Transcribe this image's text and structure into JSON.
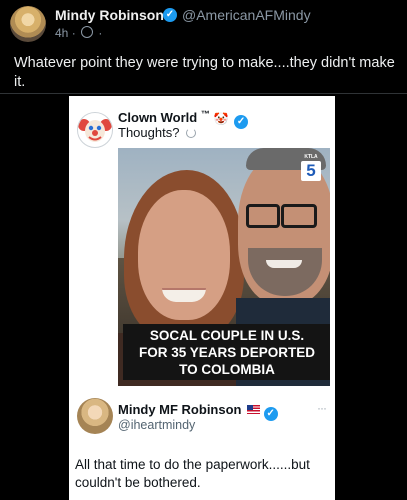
{
  "outer_post": {
    "author_name": "Mindy Robinson",
    "author_handle": "@AmericanAFMindy",
    "time_ago": "4h",
    "separator": "·",
    "text": "Whatever point they were trying to make....they didn't make it."
  },
  "quoted_post": {
    "author_name": "Clown World",
    "tm": "™",
    "clown_emoji": "🤡",
    "text": "Thoughts?"
  },
  "media": {
    "station_label": "KTLA",
    "station_number": "5",
    "caption_lines": [
      "SOCAL COUPLE IN U.S.",
      "FOR 35 YEARS DEPORTED",
      "TO COLOMBIA"
    ]
  },
  "nested_post": {
    "author_name": "Mindy MF Robinson",
    "author_handle": "@iheartmindy",
    "more_label": "···",
    "text": "All that time to do the paperwork......but couldn't be bothered."
  },
  "colors": {
    "verified_blue": "#1d9bf0",
    "background": "#000000"
  },
  "icons": [
    "verified-badge-icon",
    "globe-icon",
    "clown-emoji-icon",
    "loading-icon",
    "us-flag-icon",
    "more-icon"
  ]
}
